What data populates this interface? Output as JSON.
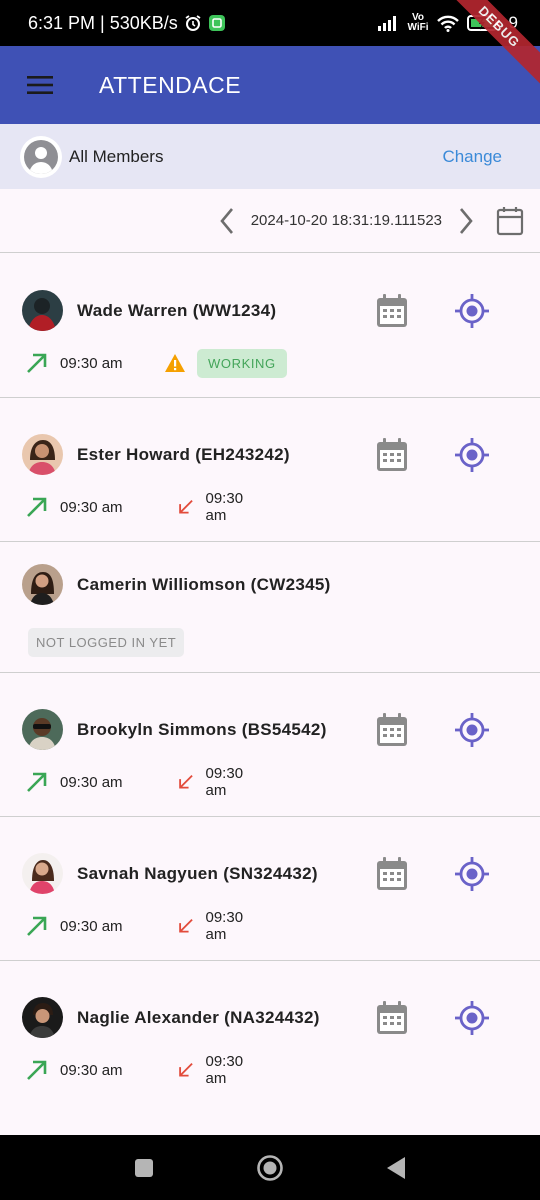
{
  "status_bar": {
    "time_speed": "6:31 PM | 530KB/s",
    "volte_top": "Vo",
    "volte_bottom": "WiFi",
    "battery_level": "9",
    "debug_banner": "DEBUG"
  },
  "app_bar": {
    "title": "ATTENDACE"
  },
  "selector": {
    "label": "All Members",
    "change_label": "Change"
  },
  "date_nav": {
    "datetime": "2024-10-20 18:31:19.111523"
  },
  "colors": {
    "app_bar": "#3f51b5",
    "accent_purple": "#6a62c8",
    "check_in_green": "#3aa655",
    "check_out_red": "#e24b3b",
    "warning_orange": "#f5a000",
    "link_blue": "#3b8ad8"
  },
  "members": [
    {
      "name": "Wade Warren (WW1234)",
      "check_in": "09:30 am",
      "status_badge": "WORKING",
      "avatar_icon": "member-photo"
    },
    {
      "name": "Ester Howard (EH243242)",
      "check_in": "09:30 am",
      "check_out": "09:30 am",
      "avatar_icon": "member-photo"
    },
    {
      "name": "Camerin Williomson (CW2345)",
      "status_badge": "NOT LOGGED IN YET",
      "avatar_icon": "member-photo"
    },
    {
      "name": "Brookyln Simmons (BS54542)",
      "check_in": "09:30 am",
      "check_out": "09:30 am",
      "avatar_icon": "member-photo"
    },
    {
      "name": "Savnah Nagyuen (SN324432)",
      "check_in": "09:30 am",
      "check_out": "09:30 am",
      "avatar_icon": "member-photo"
    },
    {
      "name": "Naglie Alexander (NA324432)",
      "check_in": "09:30 am",
      "check_out": "09:30 am",
      "avatar_icon": "member-photo"
    }
  ]
}
